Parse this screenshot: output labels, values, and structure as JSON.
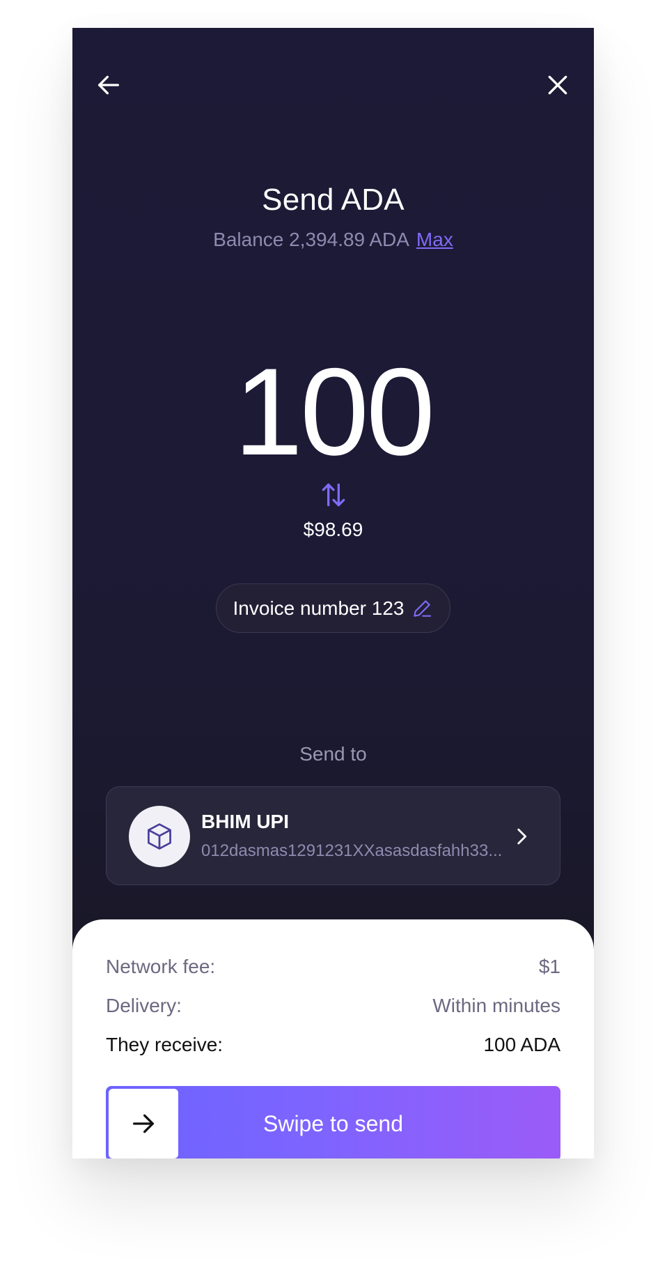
{
  "header": {
    "back_icon": "arrow-left-icon",
    "close_icon": "close-icon",
    "title": "Send ADA",
    "balance_text": "Balance 2,394.89 ADA",
    "max_label": "Max"
  },
  "amount": {
    "value": "100",
    "swap_icon": "swap-vertical-icon",
    "fiat_value": "$98.69"
  },
  "memo": {
    "text": "Invoice number 123",
    "edit_icon": "pencil-icon"
  },
  "recipient": {
    "section_label": "Send to",
    "name": "BHIM UPI",
    "address": "012dasmas1291231XXasasdasfahh33...",
    "avatar_icon": "cube-icon",
    "chevron_icon": "chevron-right-icon"
  },
  "summary": {
    "network_fee_label": "Network fee:",
    "network_fee_value": "$1",
    "delivery_label": "Delivery:",
    "delivery_value": "Within minutes",
    "receive_label": "They receive:",
    "receive_value": "100 ADA"
  },
  "action": {
    "swipe_label": "Swipe to send",
    "handle_icon": "arrow-right-icon"
  },
  "colors": {
    "background_dark": "#1d1a37",
    "accent": "#7d6cf5",
    "gradient_start": "#6c63ff",
    "gradient_end": "#9b5cf8"
  }
}
